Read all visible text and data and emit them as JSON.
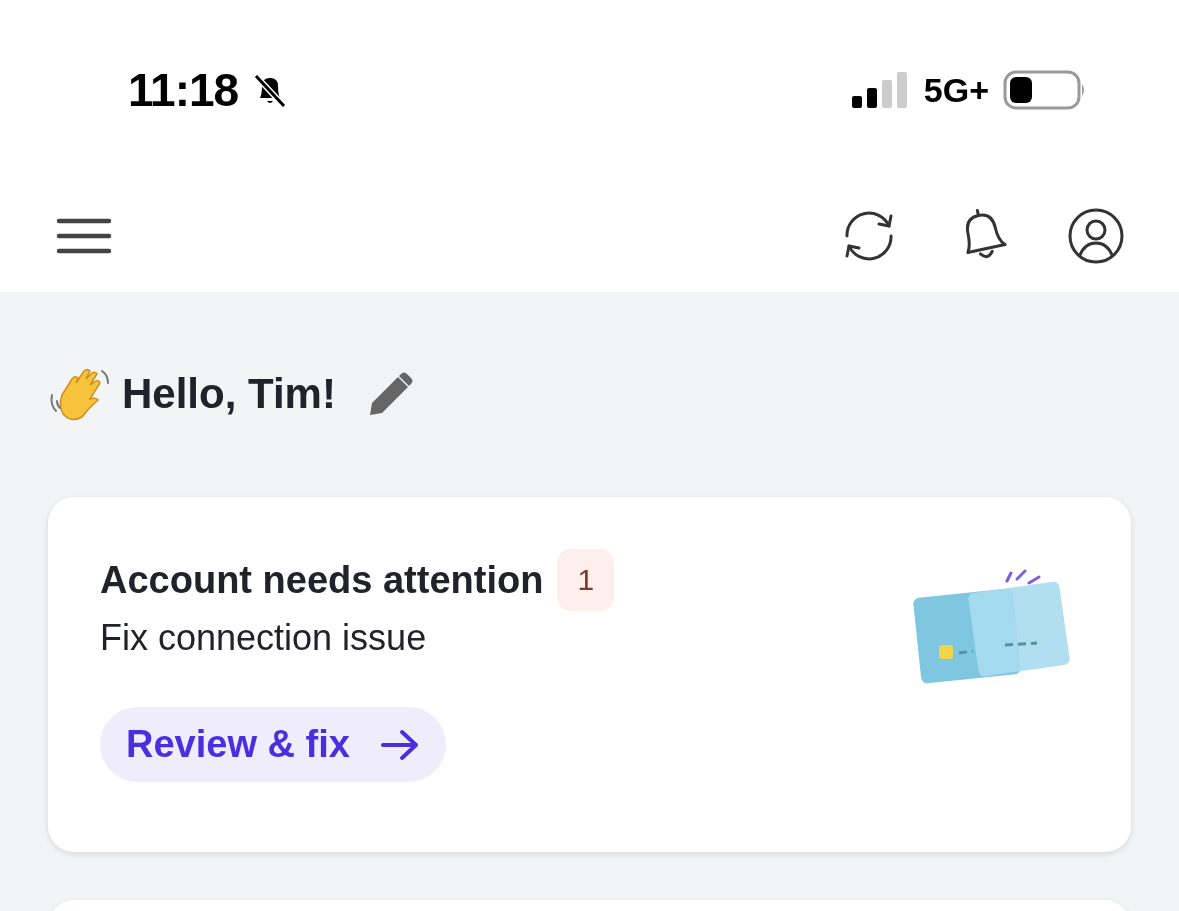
{
  "status_bar": {
    "time": "11:18",
    "network": "5G+"
  },
  "greeting": {
    "text": "Hello, Tim!"
  },
  "alert_card": {
    "title": "Account needs attention",
    "badge": "1",
    "subtitle": "Fix connection issue",
    "button": "Review & fix"
  }
}
